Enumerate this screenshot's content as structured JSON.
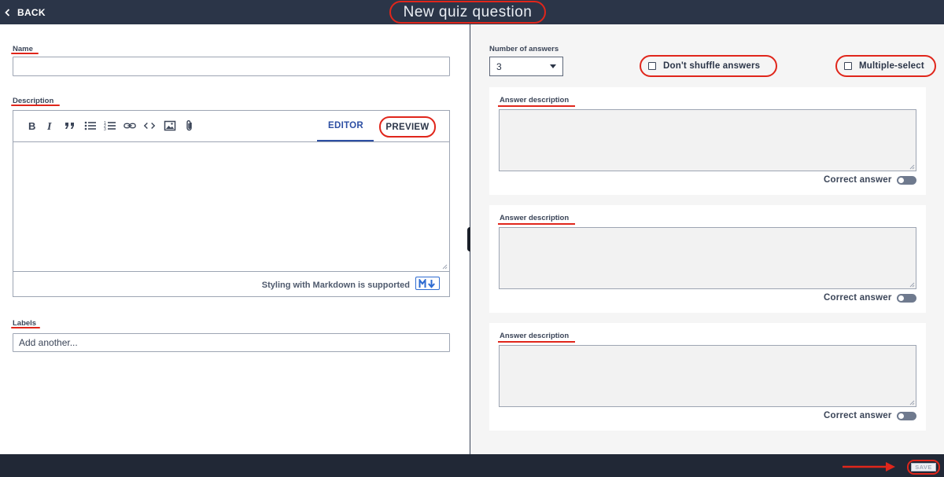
{
  "header": {
    "back_label": "BACK",
    "title": "New quiz question"
  },
  "form": {
    "name_label": "Name",
    "name_value": "",
    "description_label": "Description",
    "description_value": "",
    "editor_tabs": {
      "editor": "EDITOR",
      "preview": "PREVIEW",
      "active": "editor"
    },
    "toolbar_icons": [
      "bold-icon",
      "italic-icon",
      "quote-icon",
      "bullet-list-icon",
      "numbered-list-icon",
      "link-icon",
      "code-icon",
      "image-icon",
      "attachment-icon"
    ],
    "markdown_note": "Styling with Markdown is supported",
    "labels_label": "Labels",
    "labels_placeholder": "Add another..."
  },
  "answers_panel": {
    "num_answers_label": "Number of answers",
    "num_answers_value": "3",
    "dont_shuffle_label": "Don't shuffle answers",
    "dont_shuffle_checked": false,
    "multiple_select_label": "Multiple-select",
    "multiple_select_checked": false,
    "answers": [
      {
        "label": "Answer description",
        "value": "",
        "correct_label": "Correct answer",
        "correct": false
      },
      {
        "label": "Answer description",
        "value": "",
        "correct_label": "Correct answer",
        "correct": false
      },
      {
        "label": "Answer description",
        "value": "",
        "correct_label": "Correct answer",
        "correct": false
      }
    ]
  },
  "footer": {
    "save_label": "SAVE"
  },
  "colors": {
    "header_bg": "#2b3548",
    "footer_bg": "#212836",
    "accent_blue": "#2d4fa3",
    "annotation_red": "#e0261b",
    "right_panel_bg": "#f5f5f5"
  }
}
